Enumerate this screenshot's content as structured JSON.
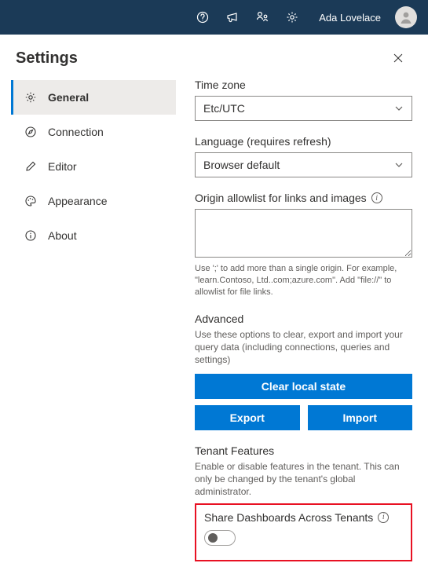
{
  "header": {
    "user_name": "Ada Lovelace"
  },
  "panel": {
    "title": "Settings"
  },
  "nav": [
    {
      "key": "general",
      "label": "General",
      "icon": "gear-icon",
      "selected": true
    },
    {
      "key": "connection",
      "label": "Connection",
      "icon": "compass-icon",
      "selected": false
    },
    {
      "key": "editor",
      "label": "Editor",
      "icon": "pencil-icon",
      "selected": false
    },
    {
      "key": "appearance",
      "label": "Appearance",
      "icon": "palette-icon",
      "selected": false
    },
    {
      "key": "about",
      "label": "About",
      "icon": "info-icon",
      "selected": false
    }
  ],
  "content": {
    "timezone": {
      "label": "Time zone",
      "value": "Etc/UTC"
    },
    "language": {
      "label": "Language (requires refresh)",
      "value": "Browser default"
    },
    "origin_allowlist": {
      "label": "Origin allowlist for links and images",
      "value": "",
      "helper": "Use ';' to add more than a single origin. For example, \"learn.Contoso, Ltd..com;azure.com\". Add \"file://\" to allowlist for file links."
    },
    "advanced": {
      "heading": "Advanced",
      "helper": "Use these options to clear, export and import your query data (including connections, queries and settings)",
      "clear_label": "Clear local state",
      "export_label": "Export",
      "import_label": "Import"
    },
    "tenant": {
      "heading": "Tenant Features",
      "helper": "Enable or disable features in the tenant. This can only be changed by the tenant's global administrator.",
      "share_label": "Share Dashboards Across Tenants",
      "share_enabled": false
    }
  }
}
